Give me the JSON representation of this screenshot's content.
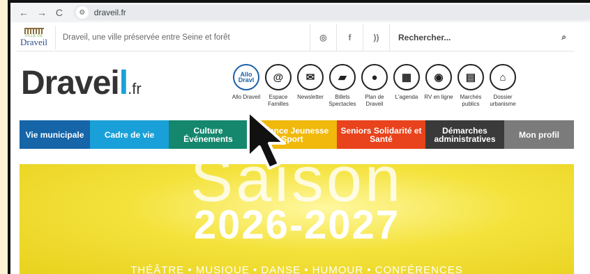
{
  "browser": {
    "url": "draveil.fr",
    "back_icon": "←",
    "forward_icon": "→",
    "reload_icon": "C",
    "site_settings_icon": "⚙"
  },
  "topbar": {
    "logo_line1": "VILLE DE",
    "logo_name": "Draveil",
    "tagline": "Draveil, une ville préservée entre Seine et forêt",
    "search_placeholder": "Rechercher...",
    "social": [
      "instagram-icon",
      "facebook-icon",
      "rss-icon"
    ]
  },
  "brand": {
    "name": "Dravei",
    "dot_letter": "l",
    "suffix": ".fr"
  },
  "shortcuts": [
    {
      "name": "allo-draveil",
      "icon": "Allo Draveil",
      "label": "Allo Draveil"
    },
    {
      "name": "espace-familles",
      "icon": "@",
      "label": "Espace Familles"
    },
    {
      "name": "newsletter",
      "icon": "✉",
      "label": "Newsletter"
    },
    {
      "name": "billets-spectacles",
      "icon": "🎟",
      "label": "Billets Spectacles"
    },
    {
      "name": "plan-de-draveil",
      "icon": "⌖",
      "label": "Plan de Draveil"
    },
    {
      "name": "agenda",
      "icon": "▦",
      "label": "L'agenda"
    },
    {
      "name": "rv-en-ligne",
      "icon": "◉",
      "label": "RV en ligne"
    },
    {
      "name": "marches-publics",
      "icon": "▤",
      "label": "Marchés publics"
    },
    {
      "name": "dossier-urbanisme",
      "icon": "⌂",
      "label": "Dossier urbanisme"
    }
  ],
  "main_nav": [
    {
      "name": "vie-municipale",
      "label": "Vie municipale",
      "color": "#1565a8",
      "width": 101
    },
    {
      "name": "cadre-de-vie",
      "label": "Cadre de vie",
      "color": "#1aa0d8",
      "width": 113
    },
    {
      "name": "culture-evenements",
      "label": "Culture Événements",
      "color": "#14876d",
      "width": 113
    },
    {
      "name": "enfance-jeunesse-sport",
      "label": "Enfance Jeunesse Sport",
      "color": "#f0b90b",
      "width": 128
    },
    {
      "name": "seniors-solidarite-sante",
      "label": "Seniors Solidarité et Santé",
      "color": "#e8431c",
      "width": 127
    },
    {
      "name": "demarches-administratives",
      "label": "Démarches administratives",
      "color": "#3a3a3a",
      "width": 113
    },
    {
      "name": "mon-profil",
      "label": "Mon profil",
      "color": "#7b7b7b",
      "width": 100
    }
  ],
  "hero": {
    "title": "Saison",
    "years": "2026-2027",
    "categories": "THÉÂTRE • MUSIQUE • DANSE • HUMOUR • CONFÉRENCES"
  }
}
